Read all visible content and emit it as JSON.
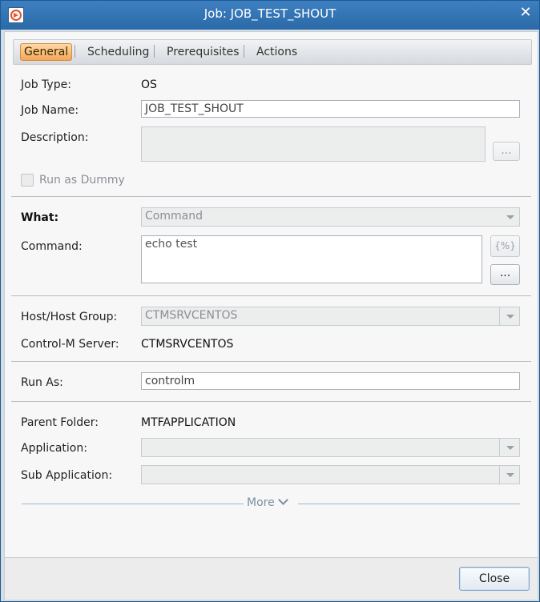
{
  "window": {
    "title": "Job: JOB_TEST_SHOUT"
  },
  "tabs": [
    {
      "label": "General",
      "active": true
    },
    {
      "label": "Scheduling",
      "active": false
    },
    {
      "label": "Prerequisites",
      "active": false
    },
    {
      "label": "Actions",
      "active": false
    }
  ],
  "general": {
    "job_type_label": "Job Type:",
    "job_type_value": "OS",
    "job_name_label": "Job Name:",
    "job_name_value": "JOB_TEST_SHOUT",
    "description_label": "Description:",
    "description_value": "",
    "description_more": "...",
    "run_as_dummy_label": "Run as Dummy",
    "run_as_dummy_checked": false
  },
  "what": {
    "what_label": "What:",
    "what_value": "Command",
    "command_label": "Command:",
    "command_value": "echo test",
    "variables_button": "{%}",
    "command_more": "..."
  },
  "host": {
    "host_label": "Host/Host Group:",
    "host_value": "CTMSRVCENTOS",
    "server_label": "Control-M Server:",
    "server_value": "CTMSRVCENTOS"
  },
  "run_as": {
    "label": "Run As:",
    "value": "controlm"
  },
  "folder": {
    "parent_label": "Parent Folder:",
    "parent_value": "MTFAPPLICATION",
    "application_label": "Application:",
    "application_value": "",
    "sub_application_label": "Sub Application:",
    "sub_application_value": ""
  },
  "more_label": "More",
  "footer": {
    "close_label": "Close"
  },
  "colors": {
    "title_bar": "#2b6aa8",
    "active_tab": "#f3a65a",
    "accent_border": "#7ea6cd"
  },
  "icons": [
    "app-icon",
    "close-icon",
    "chevron-down-icon",
    "dropdown-arrow-icon"
  ]
}
